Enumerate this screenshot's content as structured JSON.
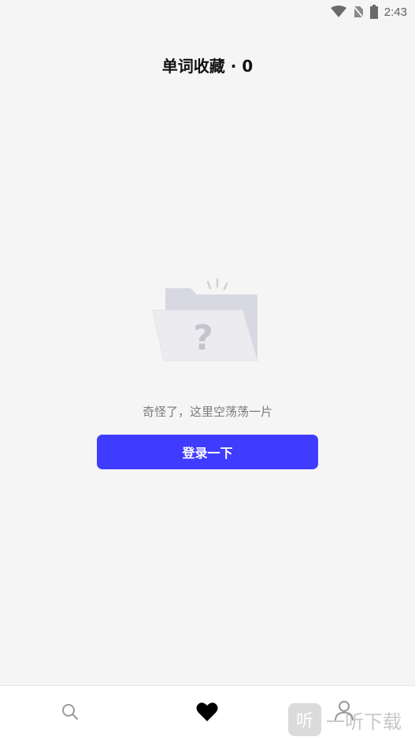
{
  "status_bar": {
    "time": "2:43"
  },
  "header": {
    "title": "单词收藏 · 0"
  },
  "empty_state": {
    "message": "奇怪了，这里空荡荡一片",
    "login_label": "登录一下",
    "login_color": "#3f3bff"
  },
  "bottom_nav": {
    "items": [
      {
        "icon": "search-icon",
        "active": false
      },
      {
        "icon": "heart-icon",
        "active": true
      },
      {
        "icon": "profile-icon",
        "active": false
      }
    ]
  },
  "watermark": {
    "logo_char": "听",
    "text": "一听下载"
  }
}
